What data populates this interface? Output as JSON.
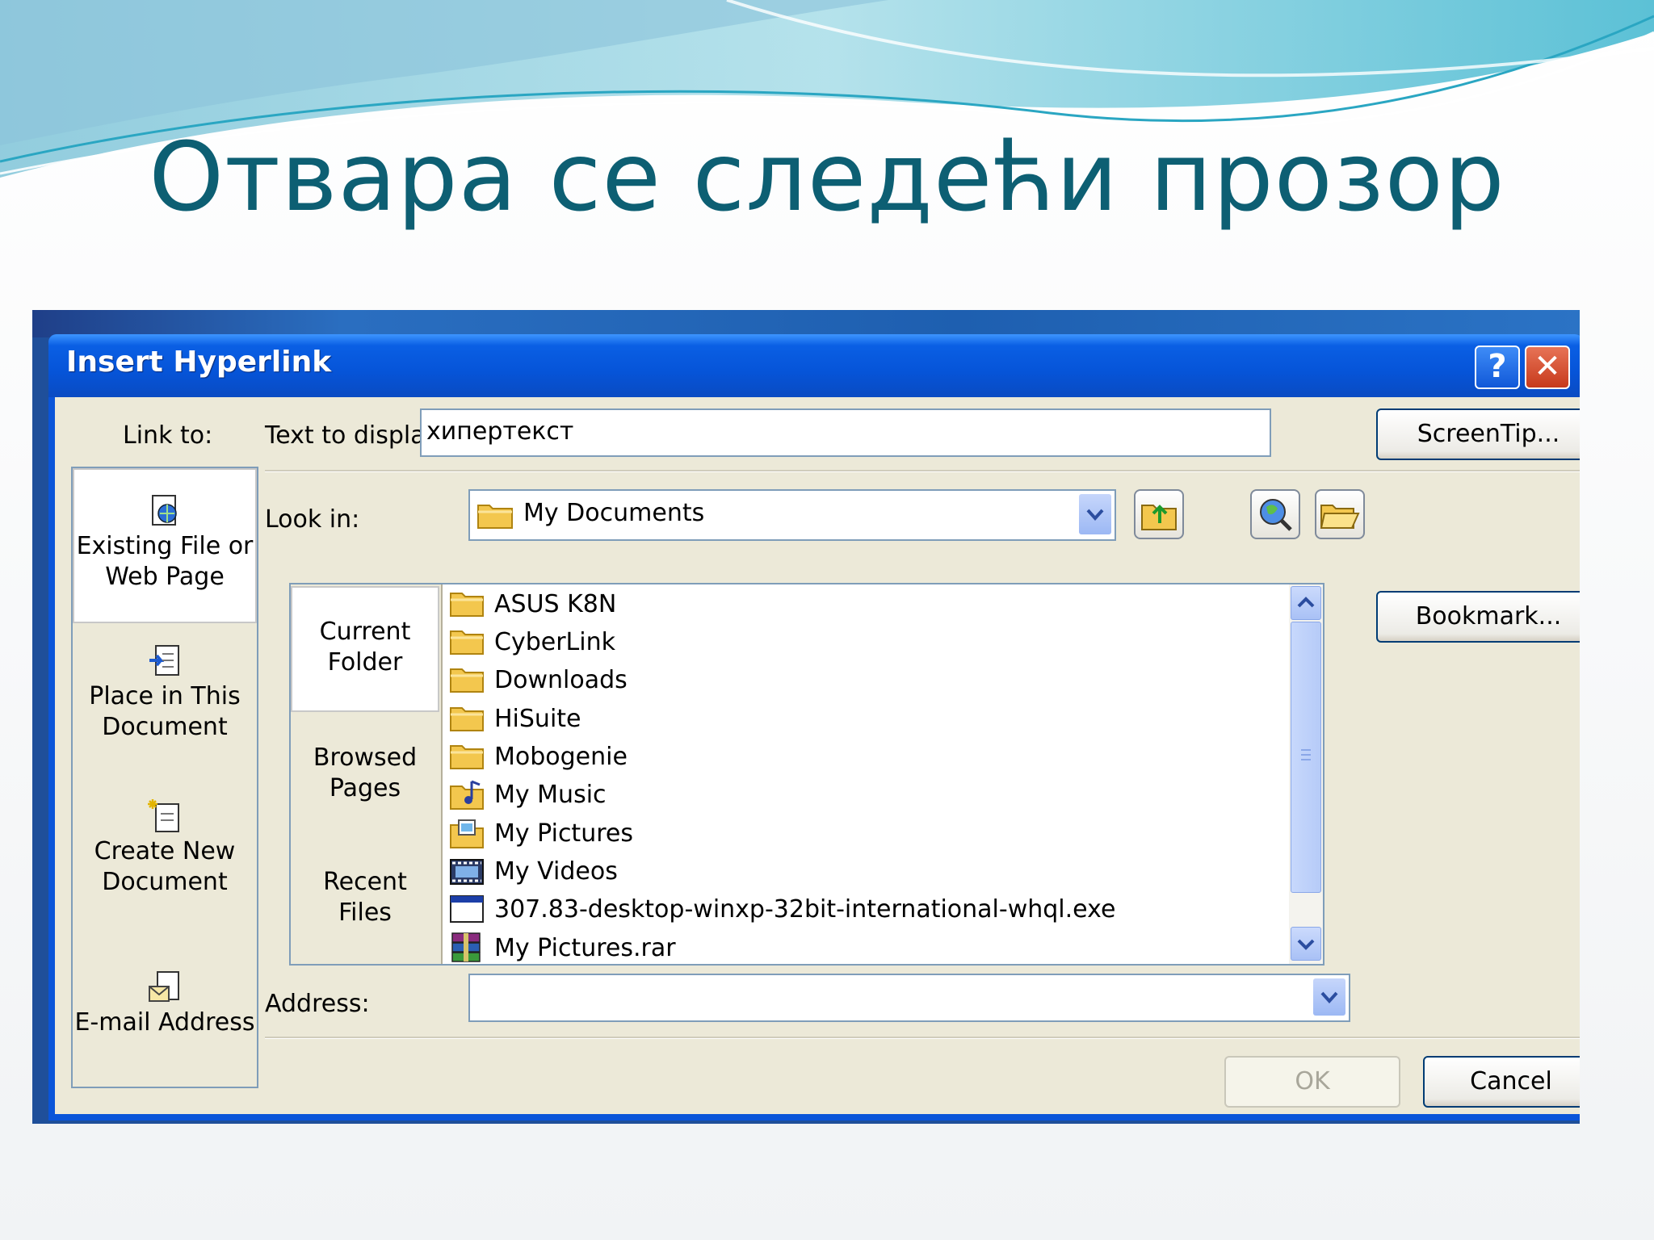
{
  "slide": {
    "title": "Отвара се следећи прозор"
  },
  "dialog": {
    "title": "Insert Hyperlink",
    "help_button": "?",
    "close_button": "✕",
    "link_to_label": "Link to:",
    "link_options": [
      {
        "line1": "Existing File or",
        "line2": "Web Page",
        "icon": "web-page-icon"
      },
      {
        "line1": "Place in This",
        "line2": "Document",
        "icon": "document-place-icon"
      },
      {
        "line1": "Create New",
        "line2": "Document",
        "icon": "new-document-icon"
      },
      {
        "line1": "E-mail Address",
        "line2": "",
        "icon": "email-icon"
      }
    ],
    "text_to_display_label": "Text to display:",
    "text_to_display_value": "хипертекст",
    "screentip_button": "ScreenTip...",
    "look_in_label": "Look in:",
    "look_in_value": "My Documents",
    "bookmark_button": "Bookmark...",
    "nav_items": [
      {
        "line1": "Current",
        "line2": "Folder"
      },
      {
        "line1": "Browsed",
        "line2": "Pages"
      },
      {
        "line1": "Recent",
        "line2": "Files"
      }
    ],
    "files": [
      {
        "name": "ASUS K8N",
        "icon": "folder-icon"
      },
      {
        "name": "CyberLink",
        "icon": "folder-icon"
      },
      {
        "name": "Downloads",
        "icon": "folder-icon"
      },
      {
        "name": "HiSuite",
        "icon": "folder-icon"
      },
      {
        "name": "Mobogenie",
        "icon": "folder-icon"
      },
      {
        "name": "My Music",
        "icon": "music-folder-icon"
      },
      {
        "name": "My Pictures",
        "icon": "pictures-folder-icon"
      },
      {
        "name": "My Videos",
        "icon": "videos-folder-icon"
      },
      {
        "name": "307.83-desktop-winxp-32bit-international-whql.exe",
        "icon": "exe-file-icon"
      },
      {
        "name": "My Pictures.rar",
        "icon": "rar-archive-icon"
      }
    ],
    "address_label": "Address:",
    "address_value": "",
    "ok_button": "OK",
    "cancel_button": "Cancel"
  },
  "colors": {
    "title_text": "#0d5f73",
    "titlebar": "#0654d8",
    "dialog_bg": "#ece9d8"
  }
}
